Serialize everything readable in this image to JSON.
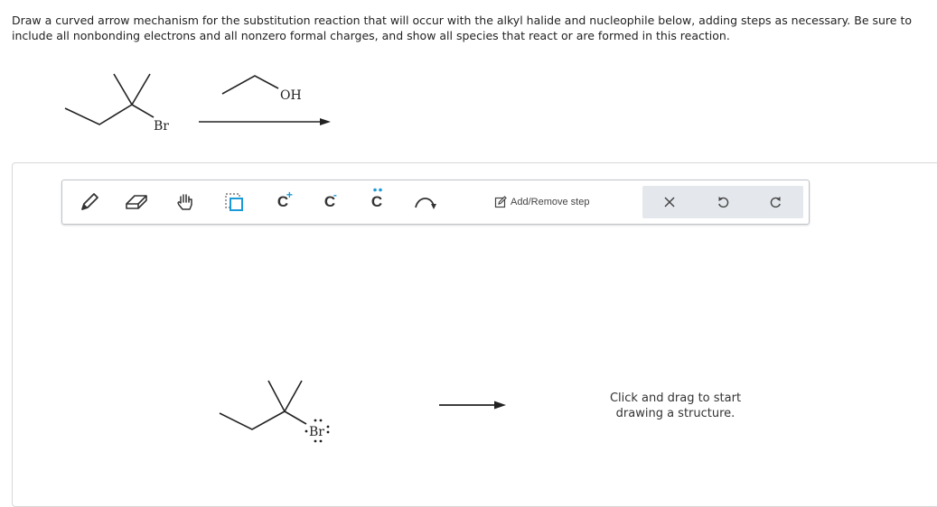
{
  "question": {
    "text": "Draw a curved arrow mechanism for the substitution reaction that will occur with the alkyl halide and nucleophile below, adding steps as necessary. Be sure to include all nonbonding electrons and all nonzero formal charges, and show all species that react or are formed in this reaction."
  },
  "reactants": {
    "alkyl_halide_atom": "Br",
    "nucleophile_atom": "OH"
  },
  "toolbar": {
    "tools": [
      {
        "name": "pencil-tool",
        "icon": "pencil-icon"
      },
      {
        "name": "eraser-tool",
        "icon": "eraser-icon"
      },
      {
        "name": "hand-tool",
        "icon": "hand-icon"
      },
      {
        "name": "select-tool",
        "icon": "dotted-square-icon"
      },
      {
        "name": "positive-charge-tool",
        "label": "C",
        "charge": "+"
      },
      {
        "name": "negative-charge-tool",
        "label": "C",
        "charge": "-"
      },
      {
        "name": "lone-pair-tool",
        "label": "C"
      },
      {
        "name": "curved-arrow-tool",
        "icon": "curved-arrow-icon"
      }
    ],
    "add_remove_step_label": "Add/Remove step",
    "clear_icon": "x-icon",
    "undo_icon": "undo-icon",
    "redo_icon": "redo-icon",
    "accent_color": "#1a9bd7"
  },
  "canvas": {
    "molecule_atom": "Br",
    "hint_line1": "Click and drag to start",
    "hint_line2": "drawing a structure."
  }
}
